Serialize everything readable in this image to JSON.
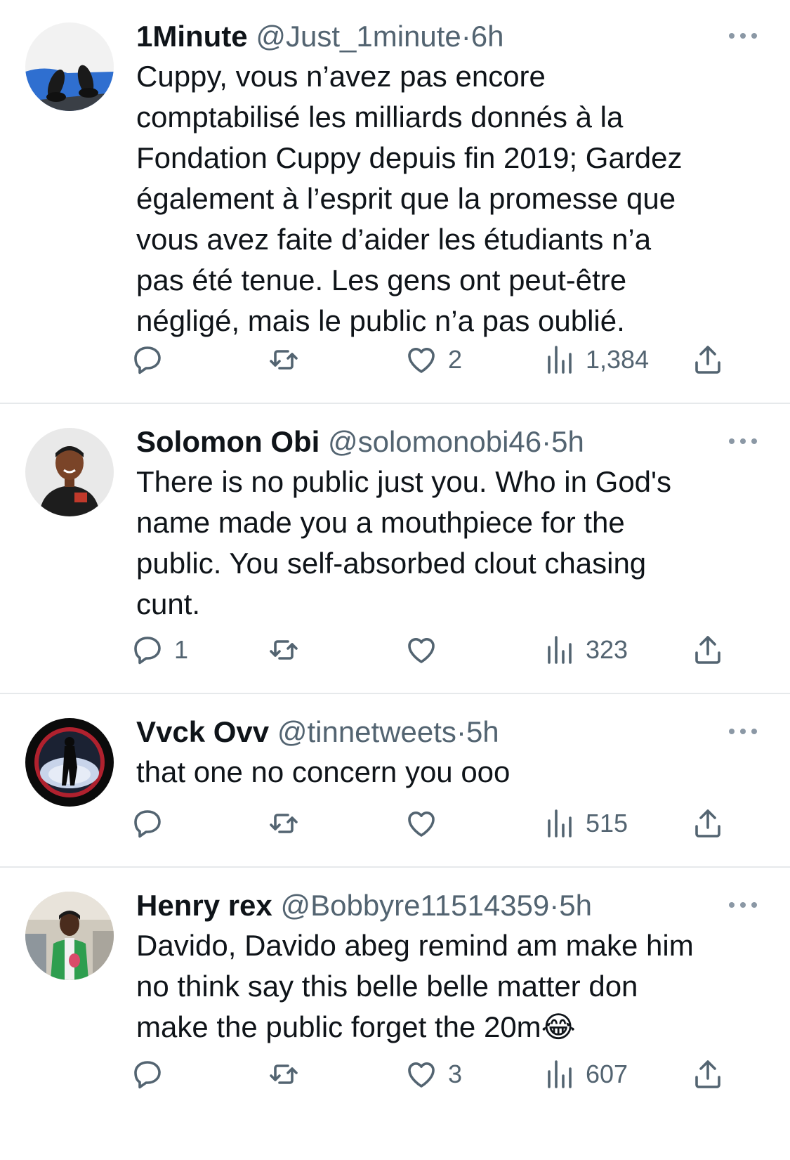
{
  "tweets": [
    {
      "name": "1Minute",
      "handle": "@Just_1minute",
      "separator": "·",
      "time": "6h",
      "lines": [
        "Cuppy, vous n’avez pas encore",
        "comptabilisé les milliards donnés à la",
        "Fondation Cuppy depuis fin 2019; Gardez",
        "également à l’esprit que la promesse que",
        "vous avez faite d’aider les étudiants n’a",
        "pas été tenue. Les gens ont peut-être",
        "négligé, mais le public n’a pas oublié."
      ],
      "emoji": "",
      "replies": "",
      "retweets": "",
      "likes": "2",
      "views": "1,384"
    },
    {
      "name": "Solomon Obi",
      "handle": "@solomonobi46",
      "separator": "·",
      "time": "5h",
      "lines": [
        "There is no public just you. Who in God's",
        "name made you a mouthpiece for the",
        "public. You self-absorbed clout chasing",
        "cunt."
      ],
      "emoji": "",
      "replies": "1",
      "retweets": "",
      "likes": "",
      "views": "323"
    },
    {
      "name": "Vvck Ovv",
      "handle": "@tinnetweets",
      "separator": "·",
      "time": "5h",
      "lines": [
        "that one no concern you ooo"
      ],
      "emoji": "",
      "replies": "",
      "retweets": "",
      "likes": "",
      "views": "515"
    },
    {
      "name": "Henry rex",
      "handle": "@Bobbyre11514359",
      "separator": "·",
      "time": "5h",
      "lines": [
        "Davido, Davido abeg remind am make him",
        "no think say this belle belle matter don",
        "make the public forget the 20m"
      ],
      "emoji": "😂",
      "replies": "",
      "retweets": "",
      "likes": "3",
      "views": "607"
    }
  ],
  "icons": {
    "reply": "speech-bubble-icon",
    "retweet": "retweet-icon",
    "like": "heart-icon",
    "views": "bar-chart-icon",
    "share": "share-icon",
    "more": "ellipsis-icon"
  },
  "colors": {
    "icon": "#536471",
    "text": "#0f1419",
    "secondary": "#536471",
    "divider": "#e6e9eb"
  }
}
